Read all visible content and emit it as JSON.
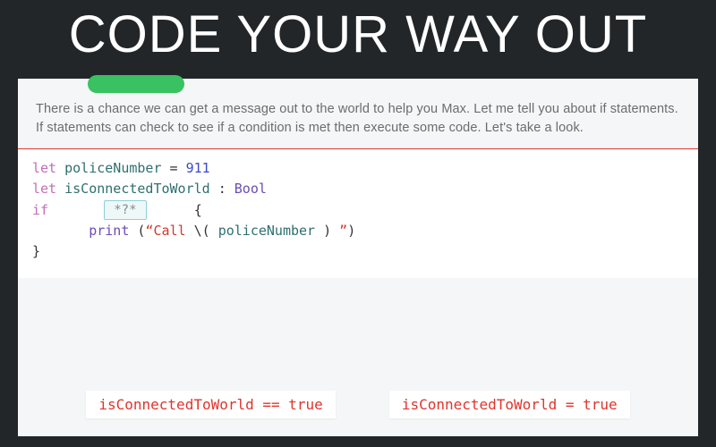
{
  "title": "CODE YOUR WAY OUT",
  "instruction": "There is a chance we can get a message out to the world to help you Max. Let me tell you about if statements. If statements can check to see if a condition is met then execute some code. Let's take a look.",
  "code": {
    "line1_let": "let",
    "line1_ident": "policeNumber",
    "line1_eq": "=",
    "line1_val": "911",
    "line2_let": "let",
    "line2_ident": "isConnectedToWorld",
    "line2_colon": ":",
    "line2_type": "Bool",
    "line3_if": "if",
    "blank_placeholder": "*?*",
    "line3_brace": "{",
    "line4_indent": "",
    "line4_fn": "print",
    "line4_open": " (",
    "line4_str_a": "“Call ",
    "line4_interp_open": "\\(",
    "line4_interp_var": " policeNumber ",
    "line4_interp_close": ")",
    "line4_str_b": " ”",
    "line4_close": ")",
    "line5_brace": "}"
  },
  "answers": {
    "left": "isConnectedToWorld == true",
    "right": "isConnectedToWorld = true"
  }
}
